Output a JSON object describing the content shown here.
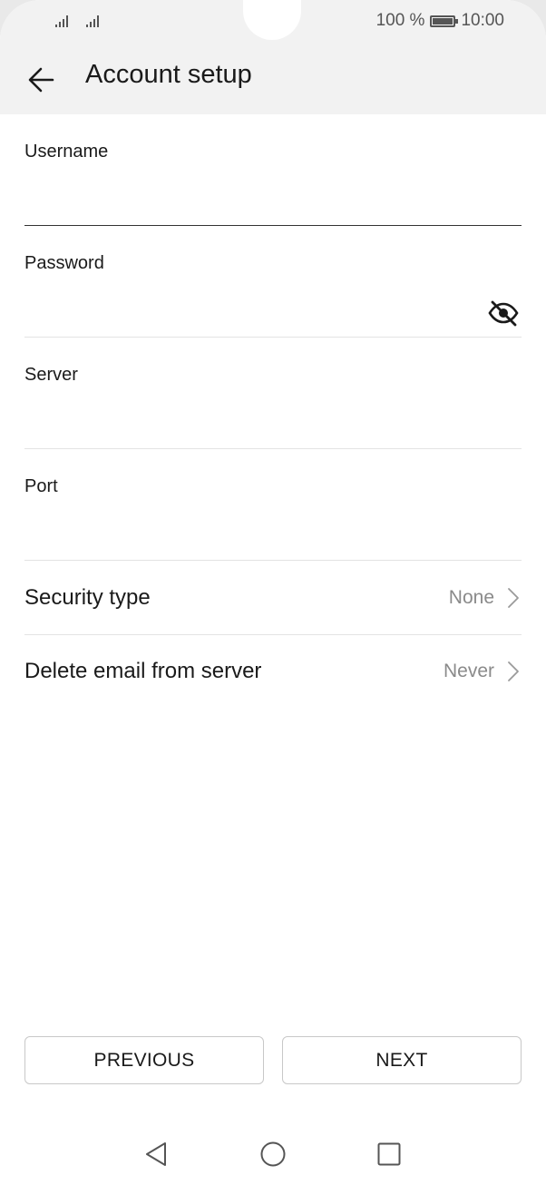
{
  "status": {
    "battery_text": "100 %",
    "time": "10:00"
  },
  "header": {
    "title": "Account setup"
  },
  "form": {
    "username": {
      "label": "Username",
      "value": ""
    },
    "password": {
      "label": "Password",
      "value": ""
    },
    "server": {
      "label": "Server",
      "value": ""
    },
    "port": {
      "label": "Port",
      "value": ""
    }
  },
  "settings": {
    "security_type": {
      "label": "Security type",
      "value": "None"
    },
    "delete_email": {
      "label": "Delete email from server",
      "value": "Never"
    }
  },
  "buttons": {
    "previous": "PREVIOUS",
    "next": "NEXT"
  },
  "icons": {
    "back": "arrow-left-icon",
    "toggle_password": "eye-off-icon",
    "chevron": "chevron-right-icon",
    "nav_back": "triangle-back-icon",
    "nav_home": "circle-home-icon",
    "nav_recent": "square-recents-icon"
  },
  "colors": {
    "header_bg": "#f2f2f2",
    "text": "#1a1a1a",
    "secondary_text": "#8a8a8a",
    "divider": "#e3e3e3"
  }
}
